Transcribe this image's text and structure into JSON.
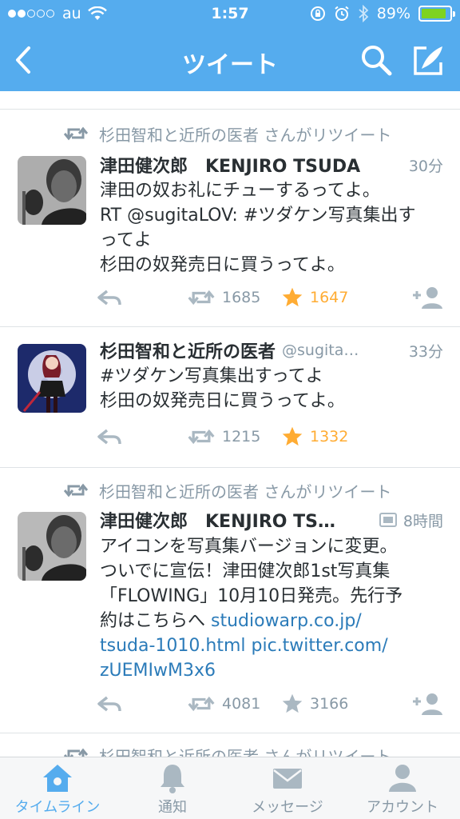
{
  "status_bar": {
    "carrier": "au",
    "time": "1:57",
    "battery_percent": "89%",
    "battery_level": 0.89,
    "icons": [
      "signal-dots",
      "wifi-icon",
      "rotation-lock-icon",
      "alarm-icon",
      "bluetooth-icon",
      "battery-icon"
    ]
  },
  "nav": {
    "title": "ツイート",
    "icons": [
      "back-chevron-icon",
      "search-icon",
      "compose-icon"
    ]
  },
  "colors": {
    "brand": "#55acee",
    "text": "#292f33",
    "muted": "#8899a6",
    "link": "#2b7bb9",
    "favorite": "#ffac33"
  },
  "tweets": [
    {
      "retweeted_by": "杉田智和と近所の医者 さんがリツイート",
      "name": "津田健次郎　KENJIRO TSUDA",
      "handle": "",
      "time": "30分",
      "lines": [
        "津田の奴お礼にチューするってよ。",
        "RT @sugitaLOV: #ツダケン写真集出す",
        "ってよ",
        "杉田の奴発売日に買うってよ。"
      ],
      "retweets": "1685",
      "favorites": "1647",
      "favorited": true
    },
    {
      "retweeted_by": "",
      "name": "杉田智和と近所の医者",
      "handle": "@sugita…",
      "time": "33分",
      "lines": [
        "#ツダケン写真集出すってよ",
        "杉田の奴発売日に買うってよ。"
      ],
      "retweets": "1215",
      "favorites": "1332",
      "favorited": true
    },
    {
      "retweeted_by": "杉田智和と近所の医者 さんがリツイート",
      "name": "津田健次郎　KENJIRO TS…",
      "handle": "",
      "time": "8時間",
      "lines": [
        "アイコンを写真集バージョンに変更。",
        "ついでに宣伝！津田健次郎1st写真集",
        "「FLOWING」10月10日発売。先行予",
        "約はこちらへ ",
        "tsuda-1010.html pic.twitter.com/",
        "zUEMIwM3x6"
      ],
      "inline_link": "studiowarp.co.jp/",
      "retweets": "4081",
      "favorites": "3166",
      "favorited": false
    }
  ],
  "partial_next_tweet": "杉田智和と近所の医者 さんがリツイート",
  "tabs": [
    {
      "label": "タイムライン",
      "icon": "home-icon",
      "active": true
    },
    {
      "label": "通知",
      "icon": "bell-icon",
      "active": false
    },
    {
      "label": "メッセージ",
      "icon": "envelope-icon",
      "active": false
    },
    {
      "label": "アカウント",
      "icon": "person-icon",
      "active": false
    }
  ]
}
